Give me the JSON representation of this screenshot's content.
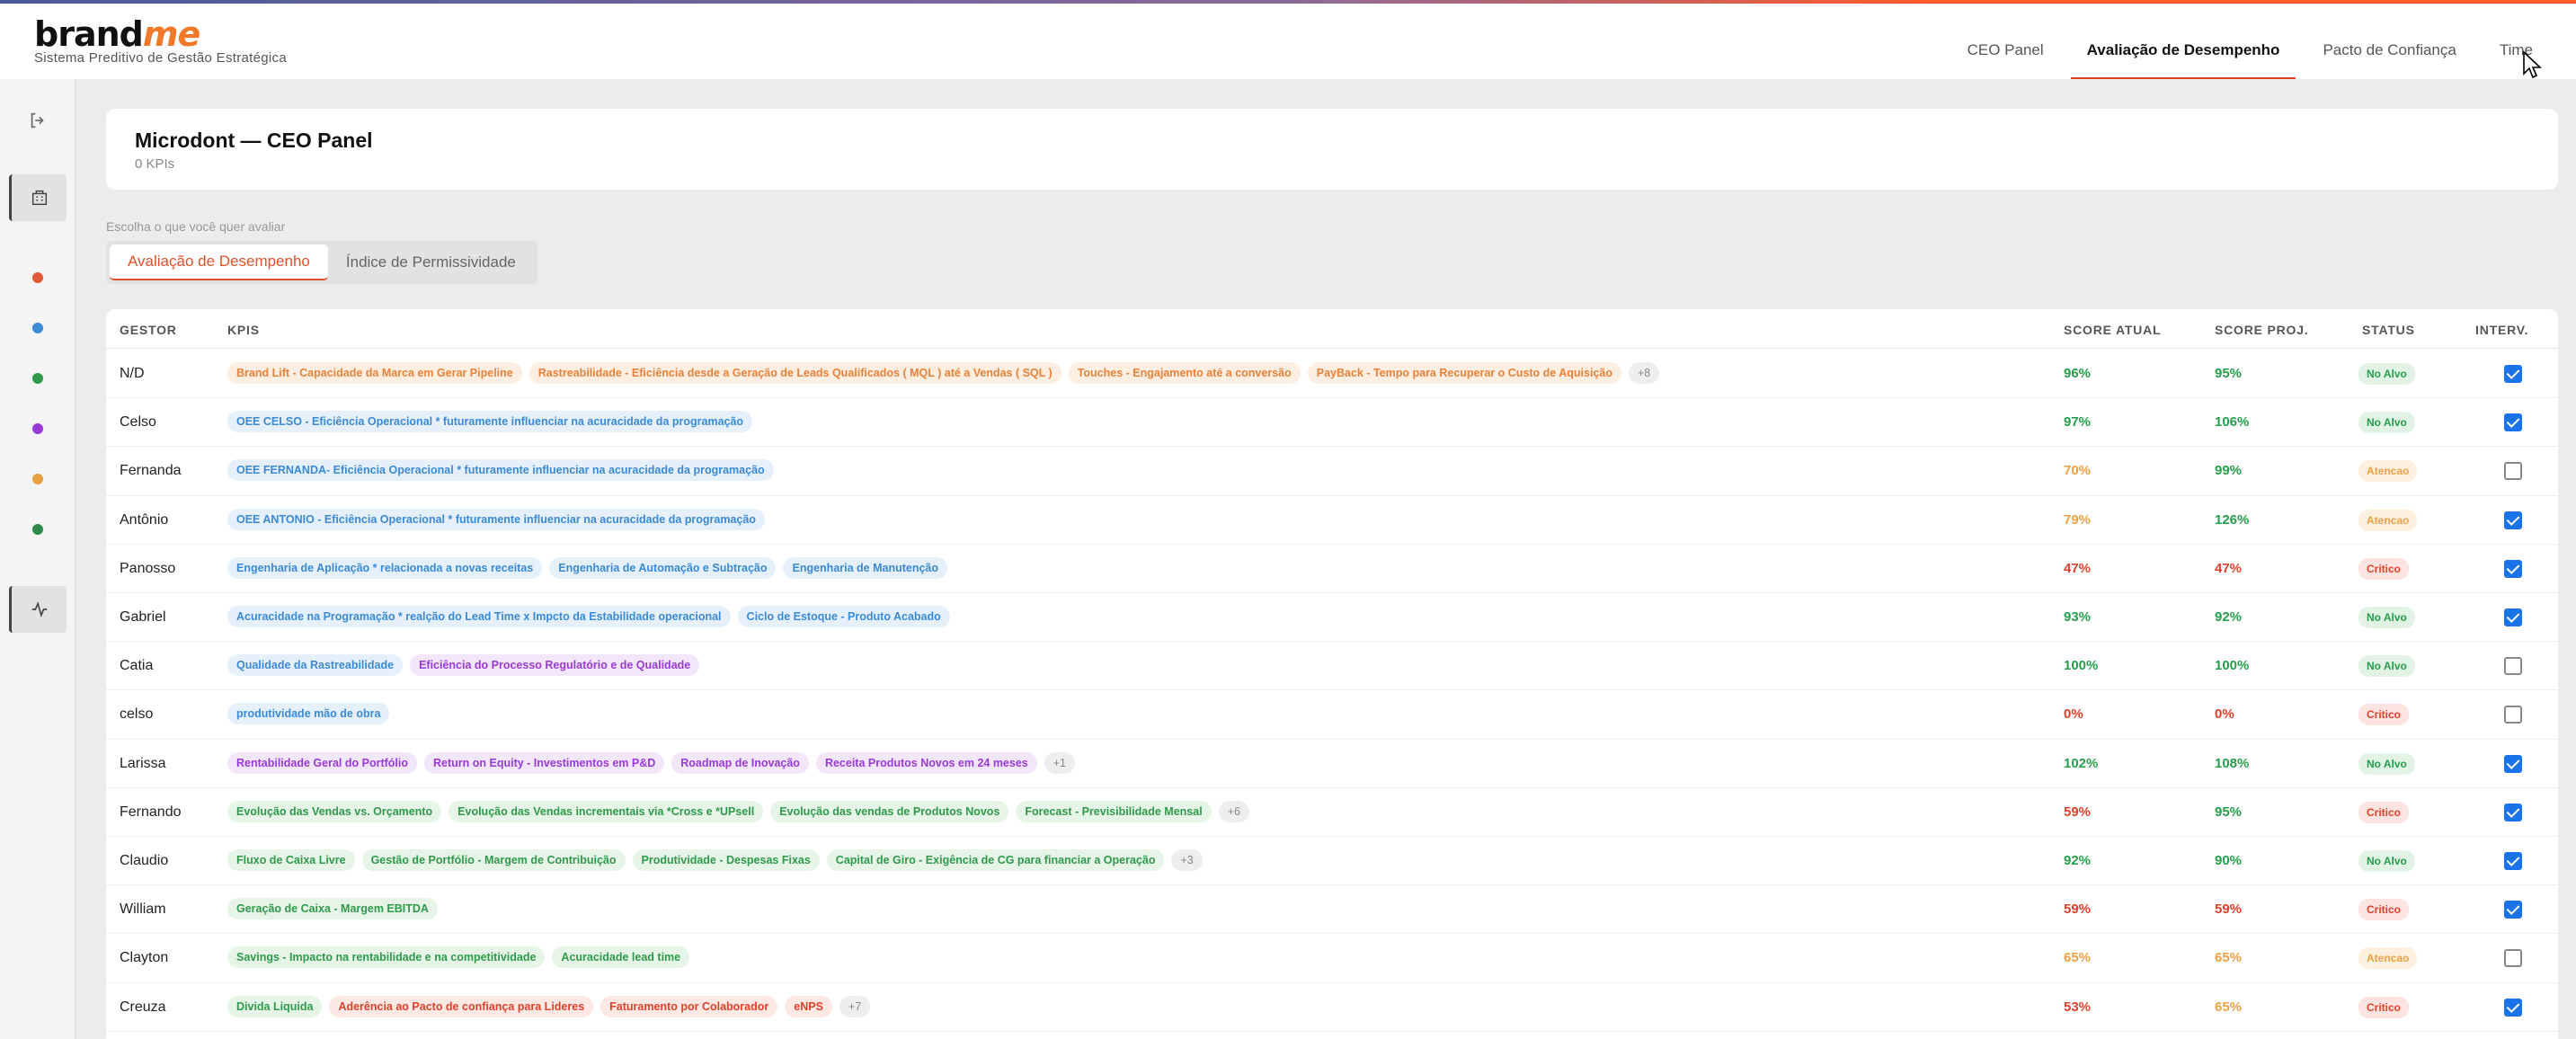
{
  "header": {
    "logo_main": "brand",
    "logo_accent": "me",
    "subtitle": "Sistema Preditivo de Gestão Estratégica",
    "tabs": [
      "CEO Panel",
      "Avaliação de Desempenho",
      "Pacto de Confiança",
      "Time"
    ],
    "active_tab": "Avaliação de Desempenho"
  },
  "sidebar": {
    "icons": [
      "logout-icon",
      "building-icon",
      "activity-icon"
    ],
    "dots": [
      "#e05a3a",
      "#3a8ad6",
      "#2f9a4a",
      "#9a3ad6",
      "#e8a040",
      "#2f8a4a"
    ]
  },
  "panel": {
    "title": "Microdont — CEO Panel",
    "count": "0 KPIs"
  },
  "selector": {
    "label": "Escolha o que você quer avaliar",
    "options": [
      "Avaliação de Desempenho",
      "Índice de Permissividade"
    ],
    "active": "Avaliação de Desempenho"
  },
  "table": {
    "headers": [
      "GESTOR",
      "KPIS",
      "SCORE ATUAL",
      "SCORE PROJ.",
      "STATUS",
      "INTERV."
    ],
    "rows": [
      {
        "gestor": "N/D",
        "kpis": [
          {
            "t": "Brand Lift - Capacidade da Marca em Gerar Pipeline",
            "c": "orange"
          },
          {
            "t": "Rastreabilidade - Eficiência desde a Geração de Leads Qualificados ( MQL ) até a Vendas ( SQL )",
            "c": "orange"
          },
          {
            "t": "Touches - Engajamento até a conversão",
            "c": "orange"
          },
          {
            "t": "PayBack - Tempo para Recuperar o Custo de Aquisição",
            "c": "orange"
          },
          {
            "t": "+8",
            "c": "more"
          }
        ],
        "atual": "96%",
        "atual_c": "green",
        "proj": "95%",
        "proj_c": "green",
        "status": "No Alvo",
        "status_c": "green",
        "interv": true
      },
      {
        "gestor": "Celso",
        "kpis": [
          {
            "t": "OEE CELSO - Eficiência Operacional * futuramente influenciar na acuracidade da programação",
            "c": "blue"
          }
        ],
        "atual": "97%",
        "atual_c": "green",
        "proj": "106%",
        "proj_c": "green",
        "status": "No Alvo",
        "status_c": "green",
        "interv": true
      },
      {
        "gestor": "Fernanda",
        "kpis": [
          {
            "t": "OEE FERNANDA- Eficiência Operacional * futuramente influenciar na acuracidade da programação",
            "c": "blue"
          }
        ],
        "atual": "70%",
        "atual_c": "orange",
        "proj": "99%",
        "proj_c": "green",
        "status": "Atencao",
        "status_c": "orange",
        "interv": false
      },
      {
        "gestor": "Antônio",
        "kpis": [
          {
            "t": "OEE ANTONIO - Eficiência Operacional * futuramente influenciar na acuracidade da programação",
            "c": "blue"
          }
        ],
        "atual": "79%",
        "atual_c": "orange",
        "proj": "126%",
        "proj_c": "green",
        "status": "Atencao",
        "status_c": "orange",
        "interv": true
      },
      {
        "gestor": "Panosso",
        "kpis": [
          {
            "t": "Engenharia de Aplicação * relacionada a novas receitas",
            "c": "blue"
          },
          {
            "t": "Engenharia de Automação e Subtração",
            "c": "blue"
          },
          {
            "t": "Engenharia de Manutenção",
            "c": "blue"
          }
        ],
        "atual": "47%",
        "atual_c": "red",
        "proj": "47%",
        "proj_c": "red",
        "status": "Critico",
        "status_c": "red",
        "interv": true
      },
      {
        "gestor": "Gabriel",
        "kpis": [
          {
            "t": "Acuracidade na Programação * realção do Lead Time x Impcto da Estabilidade operacional",
            "c": "blue"
          },
          {
            "t": "Ciclo de Estoque - Produto Acabado",
            "c": "blue"
          }
        ],
        "atual": "93%",
        "atual_c": "green",
        "proj": "92%",
        "proj_c": "green",
        "status": "No Alvo",
        "status_c": "green",
        "interv": true
      },
      {
        "gestor": "Catia",
        "kpis": [
          {
            "t": "Qualidade da Rastreabilidade",
            "c": "blue"
          },
          {
            "t": "Eficiência do Processo Regulatório e de Qualidade",
            "c": "purple"
          }
        ],
        "atual": "100%",
        "atual_c": "green",
        "proj": "100%",
        "proj_c": "green",
        "status": "No Alvo",
        "status_c": "green",
        "interv": false
      },
      {
        "gestor": "celso",
        "kpis": [
          {
            "t": "produtividade mão de obra",
            "c": "blue"
          }
        ],
        "atual": "0%",
        "atual_c": "red",
        "proj": "0%",
        "proj_c": "red",
        "status": "Critico",
        "status_c": "red",
        "interv": false
      },
      {
        "gestor": "Larissa",
        "kpis": [
          {
            "t": "Rentabilidade Geral do Portfólio",
            "c": "purple"
          },
          {
            "t": "Return on Equity - Investimentos em P&D",
            "c": "purple"
          },
          {
            "t": "Roadmap de Inovação",
            "c": "purple"
          },
          {
            "t": "Receita Produtos Novos em 24 meses",
            "c": "purple"
          },
          {
            "t": "+1",
            "c": "more"
          }
        ],
        "atual": "102%",
        "atual_c": "green",
        "proj": "108%",
        "proj_c": "green",
        "status": "No Alvo",
        "status_c": "green",
        "interv": true
      },
      {
        "gestor": "Fernando",
        "kpis": [
          {
            "t": "Evolução das Vendas vs. Orçamento",
            "c": "green"
          },
          {
            "t": "Evolução das Vendas incrementais via *Cross e *UPsell",
            "c": "green"
          },
          {
            "t": "Evolução das vendas de Produtos Novos",
            "c": "green"
          },
          {
            "t": "Forecast - Previsibilidade Mensal",
            "c": "green"
          },
          {
            "t": "+6",
            "c": "more"
          }
        ],
        "atual": "59%",
        "atual_c": "red",
        "proj": "95%",
        "proj_c": "green",
        "status": "Critico",
        "status_c": "red",
        "interv": true
      },
      {
        "gestor": "Claudio",
        "kpis": [
          {
            "t": "Fluxo de Caixa Livre",
            "c": "green"
          },
          {
            "t": "Gestão de Portfólio - Margem de Contribuição",
            "c": "green"
          },
          {
            "t": "Produtividade - Despesas Fixas",
            "c": "green"
          },
          {
            "t": "Capital de Giro - Exigência de CG para financiar a Operação",
            "c": "green"
          },
          {
            "t": "+3",
            "c": "more"
          }
        ],
        "atual": "92%",
        "atual_c": "green",
        "proj": "90%",
        "proj_c": "green",
        "status": "No Alvo",
        "status_c": "green",
        "interv": true
      },
      {
        "gestor": "William",
        "kpis": [
          {
            "t": "Geração de Caixa - Margem EBITDA",
            "c": "green"
          }
        ],
        "atual": "59%",
        "atual_c": "red",
        "proj": "59%",
        "proj_c": "red",
        "status": "Critico",
        "status_c": "red",
        "interv": true
      },
      {
        "gestor": "Clayton",
        "kpis": [
          {
            "t": "Savings - Impacto na rentabilidade e na competitividade",
            "c": "green"
          },
          {
            "t": "Acuracidade lead time",
            "c": "green"
          }
        ],
        "atual": "65%",
        "atual_c": "orange",
        "proj": "65%",
        "proj_c": "orange",
        "status": "Atencao",
        "status_c": "orange",
        "interv": false
      },
      {
        "gestor": "Creuza",
        "kpis": [
          {
            "t": "Divida Liquida",
            "c": "green"
          },
          {
            "t": "Aderência ao Pacto de confiança para Lideres",
            "c": "red"
          },
          {
            "t": "Faturamento por Colaborador",
            "c": "red"
          },
          {
            "t": "eNPS",
            "c": "red"
          },
          {
            "t": "+7",
            "c": "more"
          }
        ],
        "atual": "53%",
        "atual_c": "red",
        "proj": "65%",
        "proj_c": "orange",
        "status": "Critico",
        "status_c": "red",
        "interv": true
      }
    ]
  }
}
